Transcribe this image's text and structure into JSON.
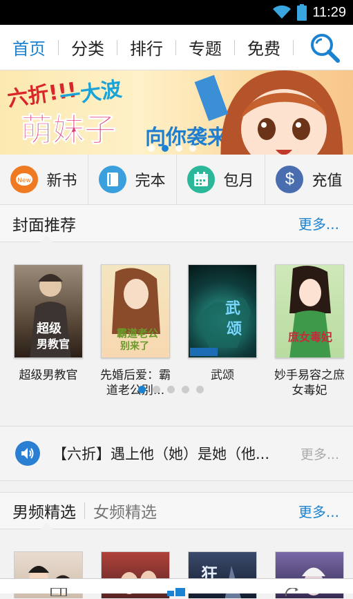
{
  "status_bar": {
    "time": "11:29"
  },
  "nav": {
    "tabs": [
      {
        "label": "首页",
        "active": true
      },
      {
        "label": "分类",
        "active": false
      },
      {
        "label": "排行",
        "active": false
      },
      {
        "label": "专题",
        "active": false
      },
      {
        "label": "免费",
        "active": false
      }
    ],
    "search_icon": "search-icon"
  },
  "banner": {
    "line1": "六折!!!",
    "line2": "一大波",
    "line3": "萌妹子",
    "line4": "向你袭来",
    "active_dot": 3,
    "dot_count": 4
  },
  "quick_actions": [
    {
      "label": "新书",
      "icon": "new-badge-icon",
      "color": "#f07a22"
    },
    {
      "label": "完本",
      "icon": "book-icon",
      "color": "#3aa0dd"
    },
    {
      "label": "包月",
      "icon": "calendar-icon",
      "color": "#2bb89a"
    },
    {
      "label": "充值",
      "icon": "dollar-icon",
      "color": "#4a6db0"
    }
  ],
  "featured": {
    "title": "封面推荐",
    "more": "更多...",
    "books": [
      {
        "title": "超级男教官",
        "cover_text": "超级男教官"
      },
      {
        "title": "先婚后爱：霸道老公别...",
        "cover_text": "霸道老公别来了"
      },
      {
        "title": "武颂",
        "cover_text": "武颂"
      },
      {
        "title": "妙手易容之庶女毒妃",
        "cover_text": "庶女毒妃"
      }
    ],
    "page_count": 5,
    "active_page": 0
  },
  "notice": {
    "text": "【六折】遇上他（她）是她（他...",
    "more": "更多..."
  },
  "picks": {
    "tab_male": "男频精选",
    "tab_female": "女频精选",
    "more": "更多..."
  },
  "colors": {
    "accent": "#1b82d1"
  }
}
